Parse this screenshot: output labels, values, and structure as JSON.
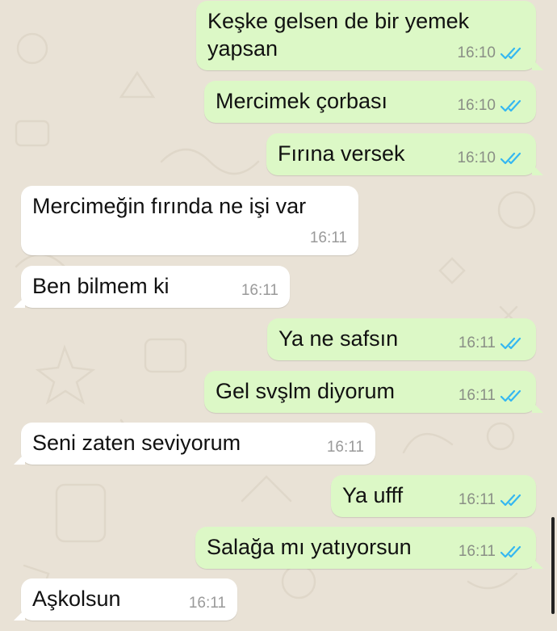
{
  "theme": {
    "outgoing_bubble": "#dcf8c6",
    "incoming_bubble": "#ffffff",
    "read_ticks": "#34b7f1",
    "wallpaper": "#e9e2d6"
  },
  "messages": [
    {
      "direction": "out",
      "text": "Keşke gelsen de bir yemek\nyapsan",
      "time": "16:10",
      "status": "read"
    },
    {
      "direction": "out",
      "text": "Mercimek çorbası",
      "time": "16:10",
      "status": "read"
    },
    {
      "direction": "out",
      "text": "Fırına versek",
      "time": "16:10",
      "status": "read"
    },
    {
      "direction": "in",
      "text": "Mercimeğin fırında ne işi var",
      "time": "16:11"
    },
    {
      "direction": "in",
      "text": "Ben bilmem ki",
      "time": "16:11"
    },
    {
      "direction": "out",
      "text": "Ya ne safsın",
      "time": "16:11",
      "status": "read"
    },
    {
      "direction": "out",
      "text": "Gel svşlm diyorum",
      "time": "16:11",
      "status": "read"
    },
    {
      "direction": "in",
      "text": "Seni zaten seviyorum",
      "time": "16:11"
    },
    {
      "direction": "out",
      "text": "Ya ufff",
      "time": "16:11",
      "status": "read"
    },
    {
      "direction": "out",
      "text": "Salağa mı yatıyorsun",
      "time": "16:11",
      "status": "read"
    },
    {
      "direction": "in",
      "text": "Aşkolsun",
      "time": "16:11"
    }
  ]
}
